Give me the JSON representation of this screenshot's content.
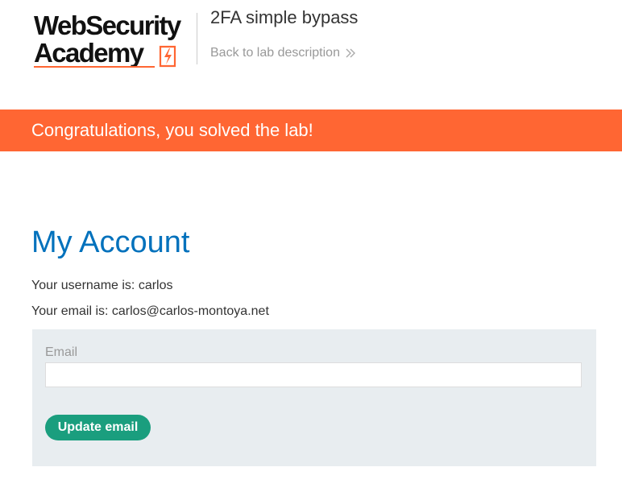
{
  "header": {
    "logo_line1": "WebSecurity",
    "logo_line2": "Academy",
    "lab_title": "2FA simple bypass",
    "back_link_label": "Back to lab description"
  },
  "banner": {
    "message": "Congratulations, you solved the lab!"
  },
  "account": {
    "heading": "My Account",
    "username_line": "Your username is: carlos",
    "email_line": "Your email is: carlos@carlos-montoya.net"
  },
  "form": {
    "email_label": "Email",
    "email_value": "",
    "submit_label": "Update email"
  },
  "colors": {
    "brand_orange": "#ff6633",
    "heading_blue": "#0071bc",
    "button_green": "#1a9e7e",
    "panel_gray": "#e8edf0"
  },
  "icons": {
    "logo_mark": "lightning-bolt-box-icon",
    "back_link": "double-chevron-right-icon"
  }
}
